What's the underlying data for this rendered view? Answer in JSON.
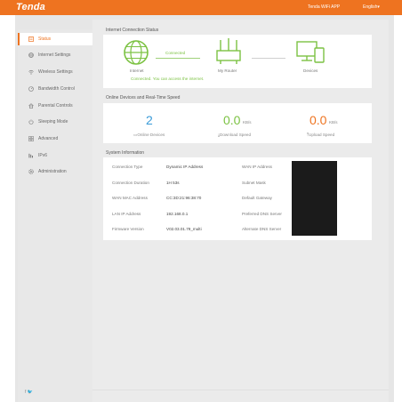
{
  "header": {
    "logo": "Tenda",
    "app_link": "Tenda WiFi APP",
    "language": "English▾"
  },
  "sidebar": {
    "items": [
      {
        "label": "Status",
        "icon": "status-icon"
      },
      {
        "label": "Internet Settings",
        "icon": "globe-icon"
      },
      {
        "label": "Wireless Settings",
        "icon": "wifi-icon"
      },
      {
        "label": "Bandwidth Control",
        "icon": "speedometer-icon"
      },
      {
        "label": "Parental Controls",
        "icon": "parental-icon"
      },
      {
        "label": "Sleeping Mode",
        "icon": "power-icon"
      },
      {
        "label": "Advanced",
        "icon": "grid-icon"
      },
      {
        "label": "IPv6",
        "icon": "ipv6-icon"
      },
      {
        "label": "Administration",
        "icon": "gear-icon"
      }
    ],
    "social": "f  🐦"
  },
  "internet_status": {
    "title": "Internet Connection Status",
    "internet_label": "Internet",
    "connected_label": "Connected",
    "router_label": "My Router",
    "devices_label": "Devices",
    "message": "Connected. You can access the internet."
  },
  "speed": {
    "title": "Online Devices and Real-Time Speed",
    "online_count": "2",
    "online_label": "Online Devices",
    "download_value": "0.0",
    "download_unit": "KB/s",
    "download_label": "Download Speed",
    "upload_value": "0.0",
    "upload_unit": "KB/s",
    "upload_label": "Upload Speed"
  },
  "system": {
    "title": "System Information",
    "left": [
      {
        "label": "Connection Type",
        "value": "Dynamic IP Address"
      },
      {
        "label": "Connection Duration",
        "value": "1H 53s"
      },
      {
        "label": "WAN MAC Address",
        "value": "CC:3D:21:96:38:70"
      },
      {
        "label": "LAN IP Address",
        "value": "192.168.0.1"
      },
      {
        "label": "Firmware Version",
        "value": "V02.03.01.79_multi"
      }
    ],
    "right": [
      {
        "label": "WAN IP Address"
      },
      {
        "label": "Subnet Mask"
      },
      {
        "label": "Default Gateway"
      },
      {
        "label": "Preferred DNS Server"
      },
      {
        "label": "Alternate DNS Server"
      }
    ]
  },
  "colors": {
    "brand": "#ee7320",
    "green": "#7cc243",
    "blue": "#3a9bd8"
  }
}
